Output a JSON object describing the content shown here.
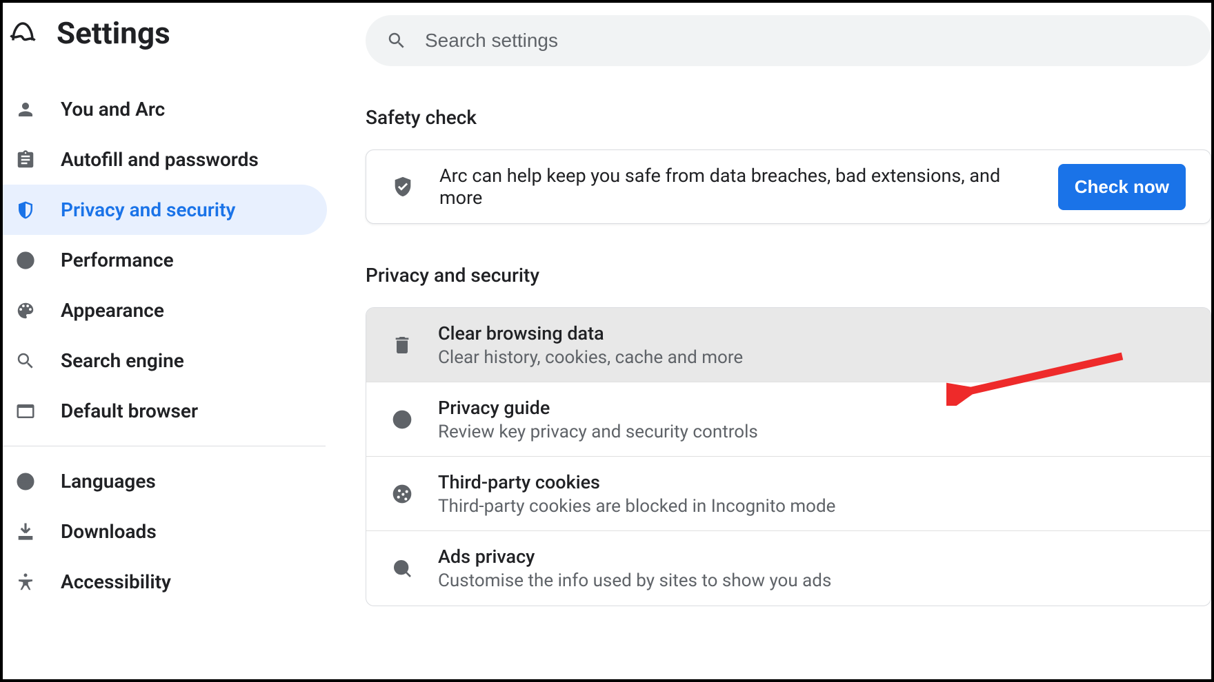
{
  "header": {
    "title": "Settings"
  },
  "search": {
    "placeholder": "Search settings"
  },
  "sidebar": {
    "items": [
      {
        "label": "You and Arc"
      },
      {
        "label": "Autofill and passwords"
      },
      {
        "label": "Privacy and security"
      },
      {
        "label": "Performance"
      },
      {
        "label": "Appearance"
      },
      {
        "label": "Search engine"
      },
      {
        "label": "Default browser"
      },
      {
        "label": "Languages"
      },
      {
        "label": "Downloads"
      },
      {
        "label": "Accessibility"
      }
    ]
  },
  "sections": {
    "safety": {
      "heading": "Safety check",
      "text": "Arc can help keep you safe from data breaches, bad extensions, and more",
      "button": "Check now"
    },
    "privacy": {
      "heading": "Privacy and security",
      "rows": [
        {
          "title": "Clear browsing data",
          "subtitle": "Clear history, cookies, cache and more"
        },
        {
          "title": "Privacy guide",
          "subtitle": "Review key privacy and security controls"
        },
        {
          "title": "Third-party cookies",
          "subtitle": "Third-party cookies are blocked in Incognito mode"
        },
        {
          "title": "Ads privacy",
          "subtitle": "Customise the info used by sites to show you ads"
        }
      ]
    }
  }
}
